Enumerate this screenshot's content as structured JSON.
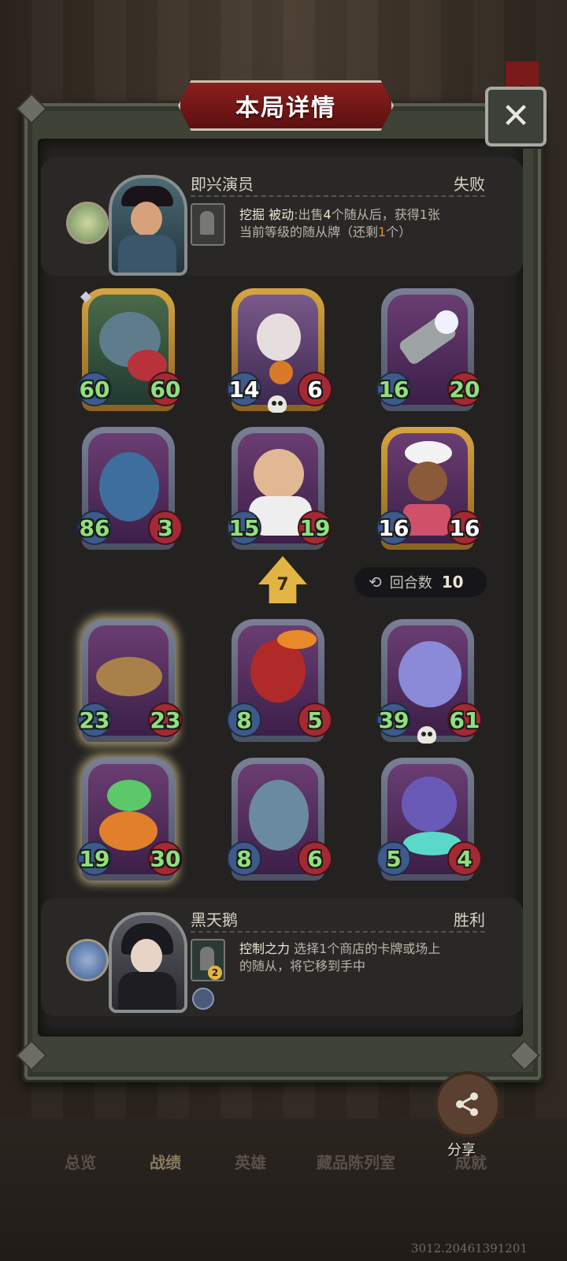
{
  "dialog": {
    "title": "本局详情",
    "close_icon": "close-icon"
  },
  "player_top": {
    "name": "即兴演员",
    "result": "失败",
    "skill_name": "挖掘",
    "skill_line1_part1": "被动",
    "skill_line1_part2": ":出售",
    "skill_line1_num": "4",
    "skill_line1_part3": "个随从后，获得1张",
    "skill_line2_part1": "当前等级的随从牌（还剩",
    "skill_line2_num": "1",
    "skill_line2_part2": "个）"
  },
  "top_board": [
    {
      "atk": "60",
      "hp": "60",
      "frame": "gold"
    },
    {
      "atk": "14",
      "hp": "6",
      "frame": "gold"
    },
    {
      "atk": "16",
      "hp": "20",
      "frame": "silver"
    },
    {
      "atk": "86",
      "hp": "3",
      "frame": "silver"
    },
    {
      "atk": "15",
      "hp": "19",
      "frame": "silver"
    },
    {
      "atk": "16",
      "hp": "16",
      "frame": "gold"
    }
  ],
  "tier": {
    "value": "7"
  },
  "rounds": {
    "label": "回合数",
    "value": "10"
  },
  "bottom_board": [
    {
      "atk": "23",
      "hp": "23"
    },
    {
      "atk": "8",
      "hp": "5"
    },
    {
      "atk": "39",
      "hp": "61"
    },
    {
      "atk": "19",
      "hp": "30"
    },
    {
      "atk": "8",
      "hp": "6"
    },
    {
      "atk": "5",
      "hp": "4"
    }
  ],
  "player_bottom": {
    "name": "黑天鹅",
    "result": "胜利",
    "skill_name": "控制之力",
    "skill_line1": "选择1个商店的卡牌或场上",
    "skill_line2": "的随从，将它移到手中",
    "skill_badge": "2"
  },
  "share": {
    "label": "分享"
  },
  "tabs": [
    "总览",
    "战绩",
    "英雄",
    "藏品陈列室",
    "成就"
  ],
  "version": "3012.20461391201"
}
